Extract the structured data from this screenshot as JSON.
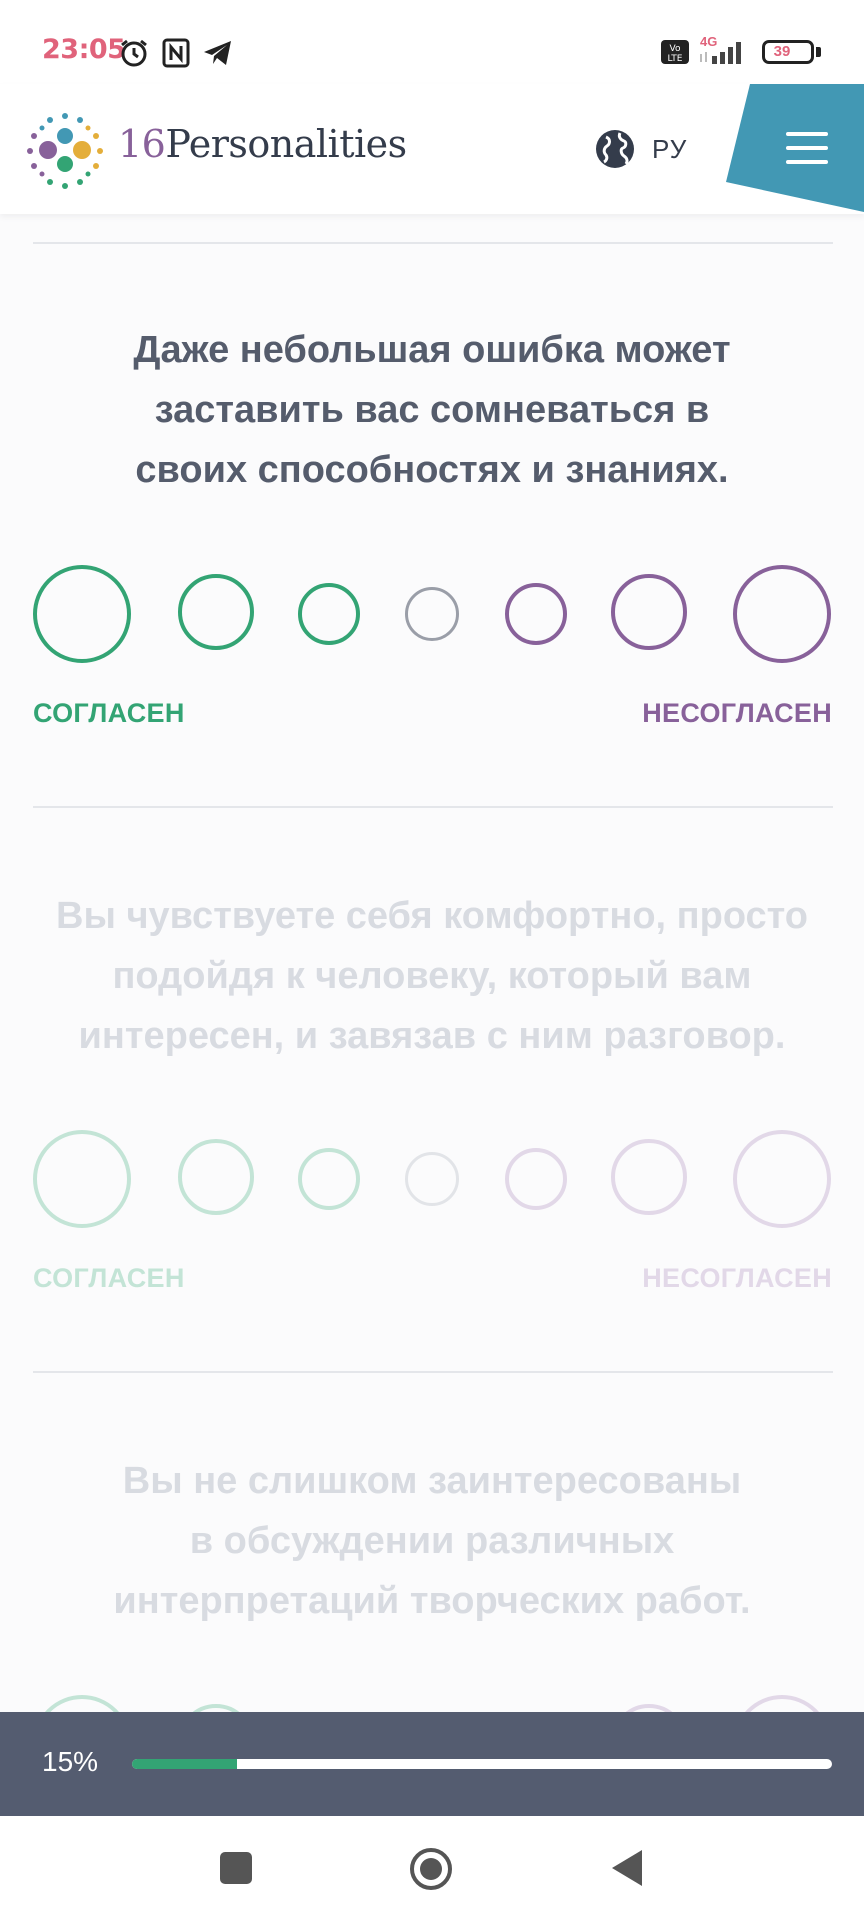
{
  "status_bar": {
    "time": "23:05",
    "battery": "39",
    "network": "4G",
    "left_icons": [
      "alarm-icon",
      "nfc-icon",
      "telegram-icon"
    ],
    "right_icons": [
      "volte-icon",
      "signal-icon",
      "battery-icon"
    ]
  },
  "header": {
    "logo_number": "16",
    "logo_word": "Personalities",
    "language": "РУ",
    "menu_icon": "hamburger-icon",
    "globe_icon": "globe-icon",
    "colors": {
      "menu_tab": "#4298b4",
      "text": "#343c4b",
      "purple": "#88619a"
    }
  },
  "questions": [
    {
      "text_lines": [
        "Даже небольшая ошибка может",
        "заставить вас сомневаться в",
        "своих способностях и знаниях."
      ],
      "agree_label": "СОГЛАСЕН",
      "disagree_label": "НЕСОГЛАСЕН",
      "state": "active"
    },
    {
      "text_lines": [
        "Вы чувствуете себя комфортно, просто",
        "подойдя к человеку, который вам",
        "интересен, и завязав с ним разговор."
      ],
      "agree_label": "СОГЛАСЕН",
      "disagree_label": "НЕСОГЛАСЕН",
      "state": "inactive"
    },
    {
      "text_lines": [
        "Вы не слишком заинтересованы",
        "в обсуждении различных",
        "интерпретаций творческих работ."
      ],
      "state": "inactive"
    }
  ],
  "progress": {
    "label": "15%",
    "value": 0.15
  },
  "colors": {
    "agree": "#33a474",
    "neutral": "#9a9ea8",
    "disagree": "#88619a",
    "progress_fill": "#33a474",
    "progress_bg": "#545c70"
  },
  "nav_bar": {
    "buttons": [
      "recent-apps-icon",
      "home-icon",
      "back-icon"
    ]
  }
}
